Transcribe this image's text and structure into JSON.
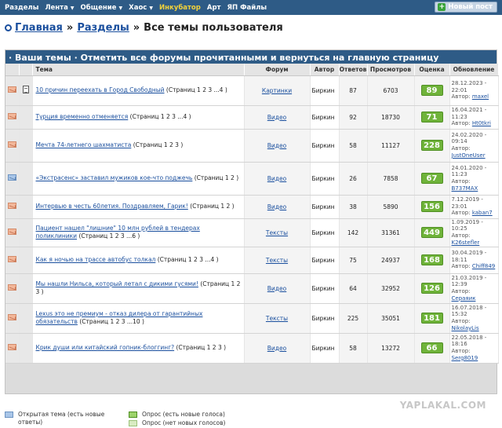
{
  "nav": {
    "items": [
      {
        "label": "Разделы",
        "caret": false,
        "active": false
      },
      {
        "label": "Лента",
        "caret": true,
        "active": false
      },
      {
        "label": "Общение",
        "caret": true,
        "active": false
      },
      {
        "label": "Хаос",
        "caret": true,
        "active": false
      },
      {
        "label": "Инкубатор",
        "caret": false,
        "active": true
      },
      {
        "label": "Арт",
        "caret": false,
        "active": false
      },
      {
        "label": "ЯП Файлы",
        "caret": false,
        "active": false
      }
    ],
    "new_post": "Новый пост"
  },
  "breadcrumb": {
    "home": "Главная",
    "sections": "Разделы",
    "sep": "»",
    "current": "Все темы пользователя"
  },
  "panel": {
    "title": "· Ваши темы · Отметить все форумы прочитанными и вернуться на главную страницу",
    "columns": [
      "",
      "",
      "Тема",
      "Форум",
      "Автор",
      "Ответов",
      "Просмотров",
      "Оценка",
      "Обновление"
    ]
  },
  "rows": [
    {
      "icon": "envelope-hot",
      "doc": true,
      "title": "10 причин переехать в Город Свободный",
      "pages": "(Страниц 1 2 3 ...4 )",
      "forum": "Картинки",
      "author": "Биркин",
      "replies": "87",
      "views": "6703",
      "score": "89",
      "date": "28.12.2023 - 22:01",
      "by": "Автор:",
      "last": "maxel"
    },
    {
      "icon": "envelope-hot",
      "doc": false,
      "title": "Турция временно отменяется",
      "pages": "(Страниц 1 2 3 ...4 )",
      "forum": "Видео",
      "author": "Биркин",
      "replies": "92",
      "views": "18730",
      "score": "71",
      "date": "16.04.2021 - 11:23",
      "by": "Автор:",
      "last": "Ht0tkri"
    },
    {
      "icon": "envelope-hot",
      "doc": false,
      "title": "Мечта 74-летнего шахматиста",
      "pages": "(Страниц 1 2 3 )",
      "forum": "Видео",
      "author": "Биркин",
      "replies": "58",
      "views": "11127",
      "score": "228",
      "date": "24.02.2020 - 09:14",
      "by": "Автор:",
      "last": "JustOneUser"
    },
    {
      "icon": "envelope-new",
      "doc": false,
      "title": "«Экстрасенс» заставил мужиков кое-что поджечь",
      "pages": "(Страниц 1 2 )",
      "forum": "Видео",
      "author": "Биркин",
      "replies": "26",
      "views": "7858",
      "score": "67",
      "date": "24.01.2020 - 11:23",
      "by": "Автор:",
      "last": "B737MAX"
    },
    {
      "icon": "envelope-hot",
      "doc": false,
      "title": "Интервью в честь 60летия. Поздравляем, Гарик!",
      "pages": "(Страниц 1 2 )",
      "forum": "Видео",
      "author": "Биркин",
      "replies": "38",
      "views": "5890",
      "score": "156",
      "date": "7.12.2019 - 23:01",
      "by": "Автор:",
      "last": "kaban7"
    },
    {
      "icon": "envelope-hot",
      "doc": false,
      "title": "Пациент нашел \"лишние\" 10 млн рублей в тендерах поликлиники",
      "pages": "(Страниц 1 2 3 ...6 )",
      "forum": "Тексты",
      "author": "Биркин",
      "replies": "142",
      "views": "31361",
      "score": "449",
      "date": "1.09.2019 - 10:25",
      "by": "Автор:",
      "last": "K26stefler"
    },
    {
      "icon": "envelope-hot",
      "doc": false,
      "title": "Как я ночью на трассе автобус толкал",
      "pages": "(Страниц 1 2 3 ...4 )",
      "forum": "Тексты",
      "author": "Биркин",
      "replies": "75",
      "views": "24937",
      "score": "168",
      "date": "30.04.2019 - 18:11",
      "by": "Автор:",
      "last": "Chiff849"
    },
    {
      "icon": "envelope-hot",
      "doc": false,
      "title": "Мы нашли Нильса, который летал с дикими гусями!",
      "pages": "(Страниц 1 2 3 )",
      "forum": "Видео",
      "author": "Биркин",
      "replies": "64",
      "views": "32952",
      "score": "126",
      "date": "21.03.2019 - 12:39",
      "by": "Автор:",
      "last": "Сераяик"
    },
    {
      "icon": "envelope-hot",
      "doc": false,
      "title": "Lexus это не премиум - отказ дилера от гарантийных обязательств",
      "pages": "(Страниц 1 2 3 ...10 )",
      "forum": "Тексты",
      "author": "Биркин",
      "replies": "225",
      "views": "35051",
      "score": "181",
      "date": "16.07.2018 - 15:32",
      "by": "Автор:",
      "last": "NikolayLis"
    },
    {
      "icon": "envelope-hot",
      "doc": false,
      "title": "Крик души или китайский гопник-блоггинг?",
      "pages": "(Страниц 1 2 3 )",
      "forum": "Видео",
      "author": "Биркин",
      "replies": "58",
      "views": "13272",
      "score": "66",
      "date": "22.05.2018 - 18:16",
      "by": "Автор:",
      "last": "Serg8019"
    }
  ],
  "legend": {
    "open_topic": "Открытая тема (есть новые ответы)",
    "poll_new": "Опрос (есть новые голоса)",
    "poll_none": "Опрос (нет новых голосов)"
  },
  "watermark": "YAPLAKAL.COM"
}
